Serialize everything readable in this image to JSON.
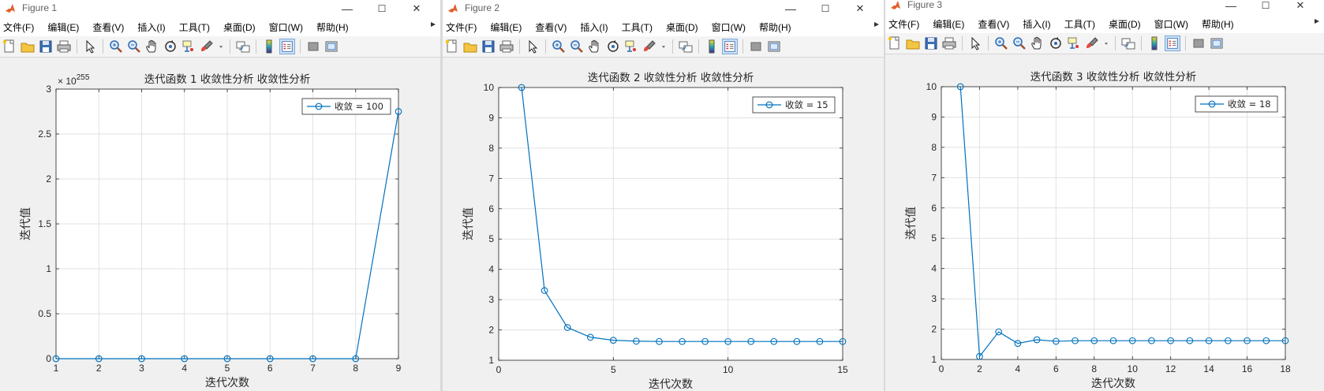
{
  "menus": [
    "文件(F)",
    "编辑(E)",
    "查看(V)",
    "插入(I)",
    "工具(T)",
    "桌面(D)",
    "窗口(W)",
    "帮助(H)"
  ],
  "window_controls": {
    "minimize": "—",
    "maximize": "☐",
    "close": "✕"
  },
  "toolbar_icons": [
    "new-figure-icon",
    "open-file-icon",
    "save-icon",
    "print-icon",
    "|",
    "pointer-icon",
    "|",
    "zoom-in-icon",
    "zoom-out-icon",
    "pan-hand-icon",
    "rotate-3d-icon",
    "data-cursor-icon",
    "brush-icon",
    "brush-dropdown-icon",
    "|",
    "link-plot-icon",
    "|",
    "colorbar-icon",
    "legend-icon",
    "|",
    "hide-plot-tools-icon",
    "show-plot-tools-icon"
  ],
  "figures": [
    {
      "title": "Figure 1",
      "chart_data": {
        "type": "line",
        "title": "迭代函数 1 收敛性分析 收敛性分析",
        "xlabel": "迭代次数",
        "ylabel": "迭代值",
        "xlim": [
          1,
          9
        ],
        "ylim": [
          0,
          3
        ],
        "xticks": [
          "1",
          "2",
          "3",
          "4",
          "5",
          "6",
          "7",
          "8",
          "9"
        ],
        "yticks": [
          "0",
          "0.5",
          "1",
          "1.5",
          "2",
          "2.5",
          "3"
        ],
        "exponent": "10",
        "exponent_power": "255",
        "x": [
          1,
          2,
          3,
          4,
          5,
          6,
          7,
          8,
          9
        ],
        "y": [
          0,
          0,
          0,
          0,
          0,
          0,
          0,
          0,
          2.75
        ],
        "series": [
          {
            "name": "收敛 = 100",
            "color": "#0072bd"
          }
        ],
        "grid": true,
        "legend_position": "top-right"
      }
    },
    {
      "title": "Figure 2",
      "chart_data": {
        "type": "line",
        "title": "迭代函数 2 收敛性分析 收敛性分析",
        "xlabel": "迭代次数",
        "ylabel": "迭代值",
        "xlim": [
          0,
          15
        ],
        "ylim": [
          1,
          10
        ],
        "xticks": [
          "0",
          "5",
          "10",
          "15"
        ],
        "yticks": [
          "1",
          "2",
          "3",
          "4",
          "5",
          "6",
          "7",
          "8",
          "9",
          "10"
        ],
        "x": [
          1,
          2,
          3,
          4,
          5,
          6,
          7,
          8,
          9,
          10,
          11,
          12,
          13,
          14,
          15
        ],
        "y": [
          10,
          3.3,
          2.08,
          1.76,
          1.66,
          1.63,
          1.62,
          1.62,
          1.62,
          1.62,
          1.62,
          1.62,
          1.62,
          1.62,
          1.62
        ],
        "series": [
          {
            "name": "收敛 = 15",
            "color": "#0072bd"
          }
        ],
        "grid": true,
        "legend_position": "top-right"
      }
    },
    {
      "title": "Figure 3",
      "chart_data": {
        "type": "line",
        "title": "迭代函数 3 收敛性分析 收敛性分析",
        "xlabel": "迭代次数",
        "ylabel": "迭代值",
        "xlim": [
          0,
          18
        ],
        "ylim": [
          1,
          10
        ],
        "xticks": [
          "0",
          "2",
          "4",
          "6",
          "8",
          "10",
          "12",
          "14",
          "16",
          "18"
        ],
        "yticks": [
          "1",
          "2",
          "3",
          "4",
          "5",
          "6",
          "7",
          "8",
          "9",
          "10"
        ],
        "x": [
          1,
          2,
          3,
          4,
          5,
          6,
          7,
          8,
          9,
          10,
          11,
          12,
          13,
          14,
          15,
          16,
          17,
          18
        ],
        "y": [
          10,
          1.1,
          1.91,
          1.53,
          1.65,
          1.6,
          1.62,
          1.62,
          1.62,
          1.62,
          1.62,
          1.62,
          1.62,
          1.62,
          1.62,
          1.62,
          1.62,
          1.62
        ],
        "series": [
          {
            "name": "收敛 = 18",
            "color": "#0072bd"
          }
        ],
        "grid": true,
        "legend_position": "top-right"
      }
    }
  ]
}
